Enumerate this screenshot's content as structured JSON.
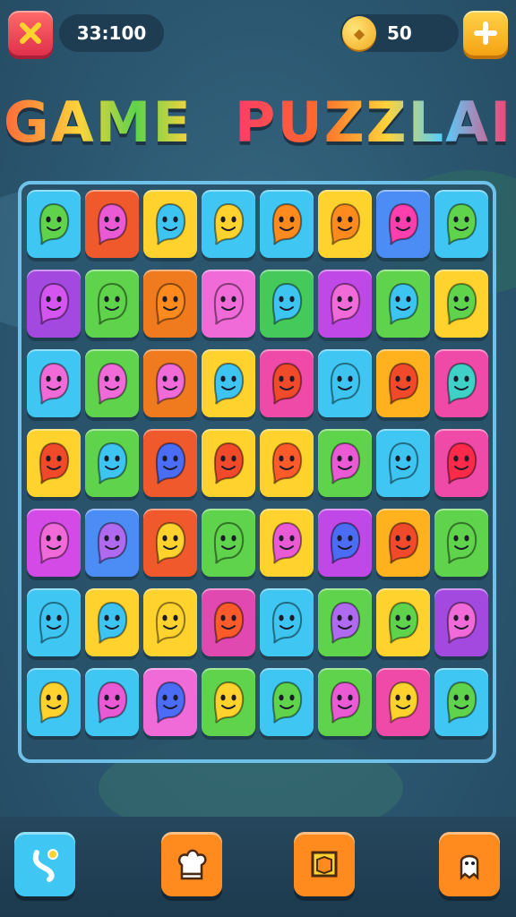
{
  "header": {
    "timer": "33:100",
    "coins": "50"
  },
  "title": {
    "word1": "GAME",
    "word2": "PUZZLAI"
  },
  "board": {
    "tiles": [
      {
        "bg": "#3fc6f2",
        "face": "#5ed34b"
      },
      {
        "bg": "#f0592c",
        "face": "#e95ad4"
      },
      {
        "bg": "#ffd22e",
        "face": "#3ec4f0"
      },
      {
        "bg": "#3fc6f2",
        "face": "#ffd22e"
      },
      {
        "bg": "#3fc6f2",
        "face": "#ff8a1e"
      },
      {
        "bg": "#ffd22e",
        "face": "#ff8a1e"
      },
      {
        "bg": "#4b8cf5",
        "face": "#ff3fae"
      },
      {
        "bg": "#3fc6f2",
        "face": "#5ed34b"
      },
      {
        "bg": "#a449e0",
        "face": "#d455f0"
      },
      {
        "bg": "#5ed34b",
        "face": "#5ed34b"
      },
      {
        "bg": "#f07a1e",
        "face": "#ff8a1e"
      },
      {
        "bg": "#f06ad8",
        "face": "#f06ad8"
      },
      {
        "bg": "#45c95a",
        "face": "#3ec4f0"
      },
      {
        "bg": "#c048e6",
        "face": "#f06ad8"
      },
      {
        "bg": "#5ed34b",
        "face": "#3ec4f0"
      },
      {
        "bg": "#ffd22e",
        "face": "#5ed34b"
      },
      {
        "bg": "#3fc6f2",
        "face": "#f06ad8"
      },
      {
        "bg": "#5ed34b",
        "face": "#f06ad8"
      },
      {
        "bg": "#f07a1e",
        "face": "#f06ad8"
      },
      {
        "bg": "#ffd22e",
        "face": "#3ec4f0"
      },
      {
        "bg": "#f04aa8",
        "face": "#f04a2a"
      },
      {
        "bg": "#3fc6f2",
        "face": "#3ec4f0"
      },
      {
        "bg": "#ffb21e",
        "face": "#f04a2a"
      },
      {
        "bg": "#f04aa8",
        "face": "#3fd0c8"
      },
      {
        "bg": "#ffd22e",
        "face": "#f04a2a"
      },
      {
        "bg": "#5ed34b",
        "face": "#3ec4f0"
      },
      {
        "bg": "#f0592c",
        "face": "#4b6cf5"
      },
      {
        "bg": "#ffd22e",
        "face": "#f04a2a"
      },
      {
        "bg": "#ffd22e",
        "face": "#ff5a2a"
      },
      {
        "bg": "#5ed34b",
        "face": "#e95ad4"
      },
      {
        "bg": "#3fc6f2",
        "face": "#3ec4f0"
      },
      {
        "bg": "#f04aa8",
        "face": "#ff2a4a"
      },
      {
        "bg": "#d44ae6",
        "face": "#f06ad8"
      },
      {
        "bg": "#4b8cf5",
        "face": "#b06af0"
      },
      {
        "bg": "#f0592c",
        "face": "#ffd22e"
      },
      {
        "bg": "#5ed34b",
        "face": "#5ed34b"
      },
      {
        "bg": "#ffd22e",
        "face": "#e95ad4"
      },
      {
        "bg": "#c048e6",
        "face": "#4b6cf5"
      },
      {
        "bg": "#ffb21e",
        "face": "#f04a2a"
      },
      {
        "bg": "#5ed34b",
        "face": "#5ed34b"
      },
      {
        "bg": "#3fc6f2",
        "face": "#3ec4f0"
      },
      {
        "bg": "#ffd22e",
        "face": "#3ec4f0"
      },
      {
        "bg": "#ffd22e",
        "face": "#ffd22e"
      },
      {
        "bg": "#e04ab0",
        "face": "#ff5a2a"
      },
      {
        "bg": "#3fc6f2",
        "face": "#3ec4f0"
      },
      {
        "bg": "#5ed34b",
        "face": "#b06af0"
      },
      {
        "bg": "#ffd22e",
        "face": "#5ed34b"
      },
      {
        "bg": "#a449e0",
        "face": "#f06ad8"
      },
      {
        "bg": "#3fc6f2",
        "face": "#ffd22e"
      },
      {
        "bg": "#3fc6f2",
        "face": "#e95ad4"
      },
      {
        "bg": "#f06ad8",
        "face": "#4b6cf5"
      },
      {
        "bg": "#5ed34b",
        "face": "#ffd22e"
      },
      {
        "bg": "#3fc6f2",
        "face": "#5ed34b"
      },
      {
        "bg": "#5ed34b",
        "face": "#e95ad4"
      },
      {
        "bg": "#f04aa8",
        "face": "#ffd22e"
      },
      {
        "bg": "#3fc6f2",
        "face": "#5ed34b"
      }
    ]
  },
  "footer": {
    "buttons": [
      {
        "name": "hint-button",
        "icon": "path-icon",
        "bg": "#3fc6f2"
      },
      {
        "name": "chef-button",
        "icon": "chef-hat-icon",
        "bg": "#ff8a1e"
      },
      {
        "name": "map-button",
        "icon": "treasure-map-icon",
        "bg": "#ff8a1e"
      },
      {
        "name": "ghost-button",
        "icon": "ghost-icon",
        "bg": "#ff8a1e"
      }
    ]
  }
}
